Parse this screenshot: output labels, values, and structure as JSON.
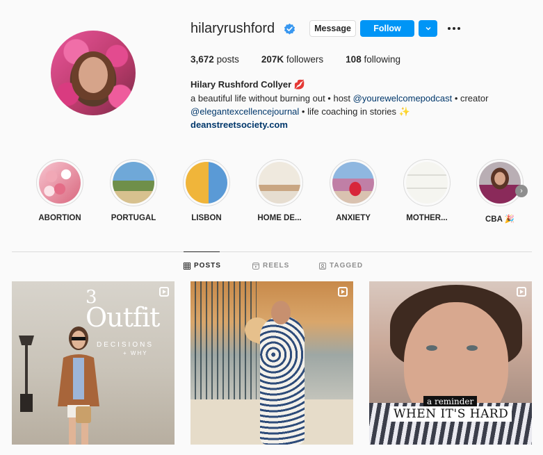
{
  "profile": {
    "username": "hilaryrushford",
    "verified_icon": "verified-badge-icon",
    "message_label": "Message",
    "follow_label": "Follow",
    "dropdown_icon": "chevron-down-icon",
    "more_icon": "more-options-icon",
    "posts_count": "3,672",
    "posts_label": "posts",
    "followers_count": "207K",
    "followers_label": "followers",
    "following_count": "108",
    "following_label": "following",
    "full_name": "Hilary Rushford Collyer 💋",
    "bio_line1_a": "a beautiful life without burning out • host ",
    "bio_line1_link": "@yourewelcomepodcast",
    "bio_line1_b": " • creator",
    "bio_line2_link": "@elegantexcellencejournal",
    "bio_line2_b": " • life coaching in stories ✨",
    "website": "deanstreetsociety.com"
  },
  "highlights": [
    {
      "label": "ABORTION"
    },
    {
      "label": "PORTUGAL"
    },
    {
      "label": "LISBON"
    },
    {
      "label": "HOME DE..."
    },
    {
      "label": "ANXIETY"
    },
    {
      "label": "MOTHER..."
    },
    {
      "label": "CBA 🎉"
    }
  ],
  "tabs": [
    {
      "label": "POSTS",
      "icon": "grid-icon",
      "active": true
    },
    {
      "label": "REELS",
      "icon": "reels-icon",
      "active": false
    },
    {
      "label": "TAGGED",
      "icon": "tagged-icon",
      "active": false
    }
  ],
  "posts": [
    {
      "overlay_number": "3",
      "overlay_title": "Outfit",
      "overlay_sub": "DECISIONS",
      "overlay_sub2": "+ WHY",
      "icon": "reel-icon"
    },
    {
      "icon": "reel-icon"
    },
    {
      "caption_top": "a reminder",
      "caption_bottom": "WHEN IT'S HARD",
      "icon": "reel-icon"
    }
  ],
  "colors": {
    "follow_blue": "#0095f6",
    "link_blue": "#00376b",
    "verified_blue": "#3897f0",
    "background": "#fafafa"
  }
}
